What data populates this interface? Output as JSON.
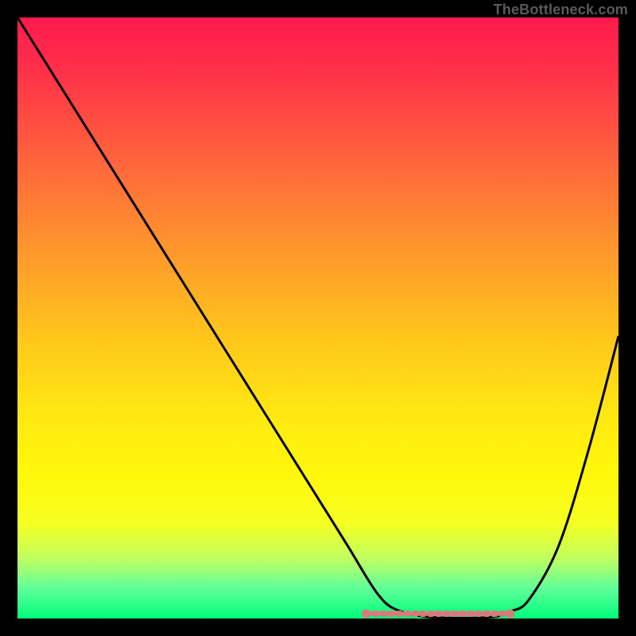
{
  "watermark": "TheBottleneck.com",
  "chart_data": {
    "type": "line",
    "title": "",
    "xlabel": "",
    "ylabel": "",
    "xlim": [
      0,
      100
    ],
    "ylim": [
      0,
      100
    ],
    "grid": false,
    "curve": {
      "name": "bottleneck-curve",
      "color": "#000000",
      "x": [
        0,
        5,
        10,
        15,
        20,
        25,
        30,
        35,
        40,
        45,
        50,
        55,
        58,
        60,
        62,
        65,
        68,
        72,
        76,
        80,
        82,
        85,
        90,
        95,
        100
      ],
      "y": [
        100,
        92,
        84,
        76,
        68,
        60,
        52,
        44,
        36,
        28,
        20,
        12,
        7,
        4,
        2,
        0.8,
        0.3,
        0.1,
        0.1,
        0.4,
        1.2,
        3,
        12,
        28,
        47
      ]
    },
    "flat_band": {
      "name": "optimal-range-marker",
      "color": "#d97a7a",
      "x": [
        58,
        82
      ],
      "y": 0.8
    },
    "background_gradient": {
      "top": "#ff1a4d",
      "mid": "#ffe812",
      "bottom": "#00ff7a"
    }
  }
}
